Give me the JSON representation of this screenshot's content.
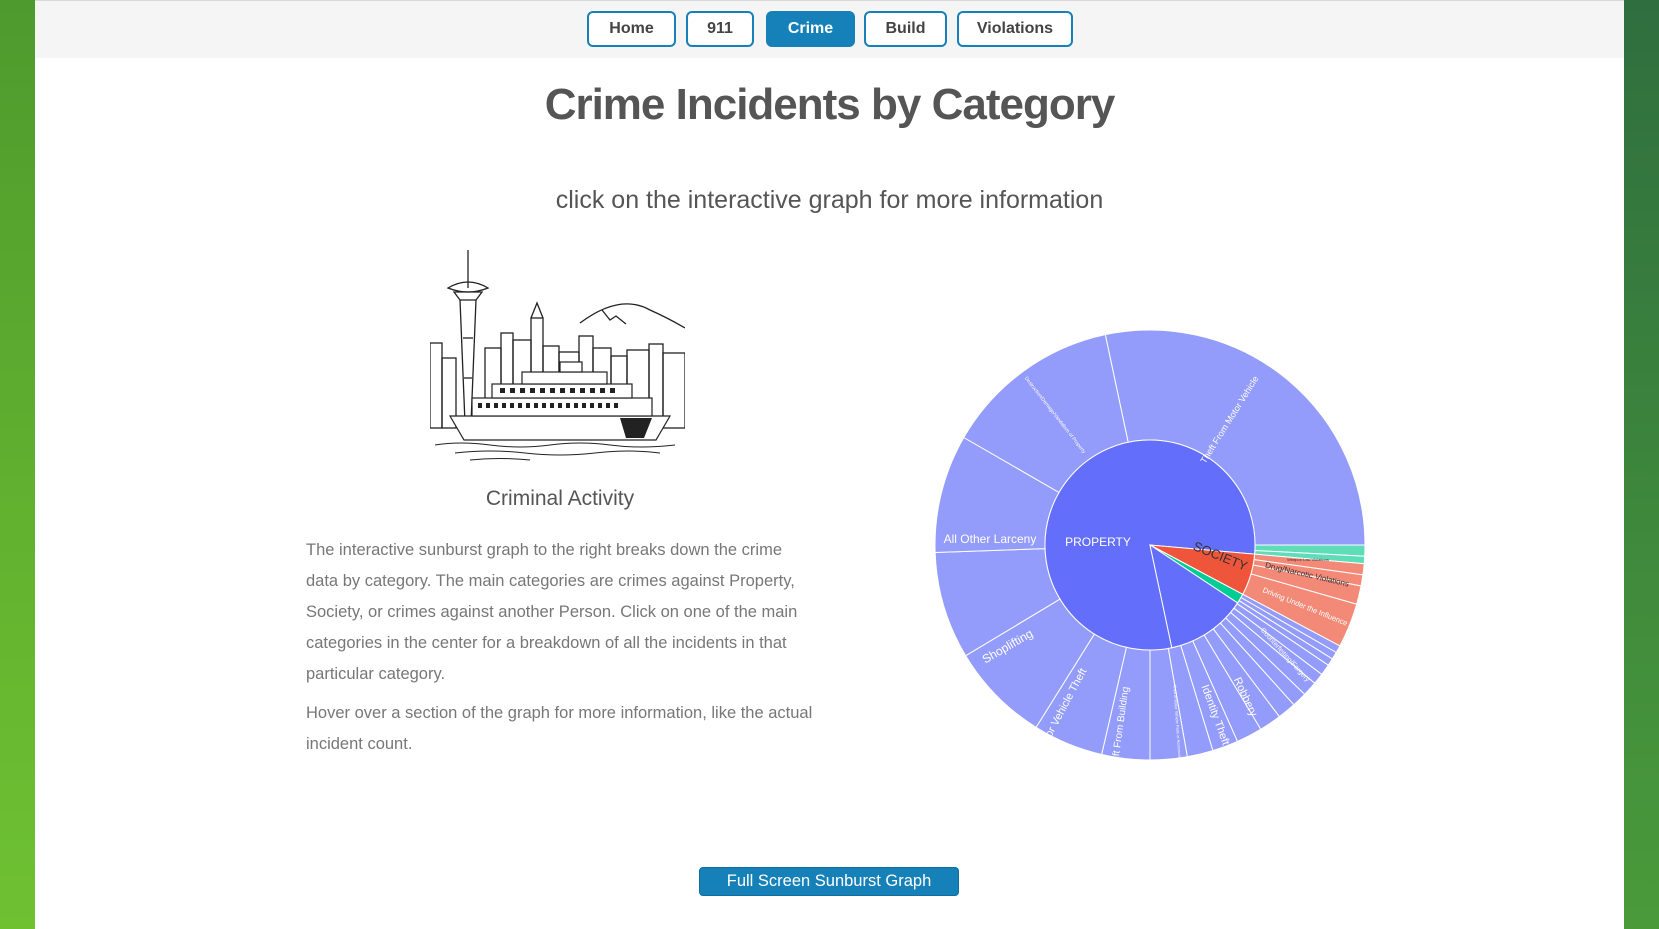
{
  "nav": {
    "items": [
      {
        "label": "Home"
      },
      {
        "label": "911"
      },
      {
        "label": "Crime"
      },
      {
        "label": "Build"
      },
      {
        "label": "Violations"
      }
    ],
    "active": "Crime"
  },
  "page": {
    "title": "Crime Incidents by Category",
    "subtitle": "click on the interactive graph for more information",
    "image_caption": "Criminal Activity",
    "paragraph_1": "The interactive sunburst graph to the right breaks down the crime data by category. The main categories are crimes against Property, Society, or crimes against another Person. Click on one of the main categories in the center for a breakdown of all the incidents in that particular category.",
    "paragraph_2": "Hover over a section of the graph for more information, like the actual incident count.",
    "fullscreen_button": "Full Screen Sunburst Graph"
  },
  "colors": {
    "accent": "#1581b8",
    "property": "#636efa",
    "property_outer": "#939bfb",
    "society": "#ef553b",
    "society_outer": "#f38a78",
    "person": "#00cc96",
    "person_outer": "#5fdcb8"
  },
  "chart_data": {
    "type": "sunburst",
    "inner": [
      {
        "label": "PROPERTY",
        "share": 0.805
      },
      {
        "label": "SOCIETY",
        "share": 0.065
      },
      {
        "label": "",
        "share": 0.015
      },
      {
        "label": "",
        "share": 0.115
      }
    ],
    "outer_labeled": [
      {
        "label": "Theft From Motor Vehicle",
        "parent": "PROPERTY"
      },
      {
        "label": "Destruction/Damage/Vandalism of Property",
        "parent": "PROPERTY"
      },
      {
        "label": "All Other Larceny",
        "parent": "PROPERTY"
      },
      {
        "label": "Shoplifting",
        "parent": "PROPERTY"
      },
      {
        "label": "Motor Vehicle Theft",
        "parent": "PROPERTY"
      },
      {
        "label": "Theft From Building",
        "parent": "PROPERTY"
      },
      {
        "label": "Theft of Motor Vehicle Parts or Accessories",
        "parent": "PROPERTY"
      },
      {
        "label": "Identity Theft",
        "parent": "PROPERTY"
      },
      {
        "label": "Robbery",
        "parent": "PROPERTY"
      },
      {
        "label": "Counterfeiting/Forgery",
        "parent": "PROPERTY"
      },
      {
        "label": "Drug/Narcotic Violations",
        "parent": "SOCIETY"
      },
      {
        "label": "Driving Under the Influence",
        "parent": "SOCIETY"
      },
      {
        "label": "Weapon Law Violations",
        "parent": "SOCIETY"
      }
    ]
  }
}
